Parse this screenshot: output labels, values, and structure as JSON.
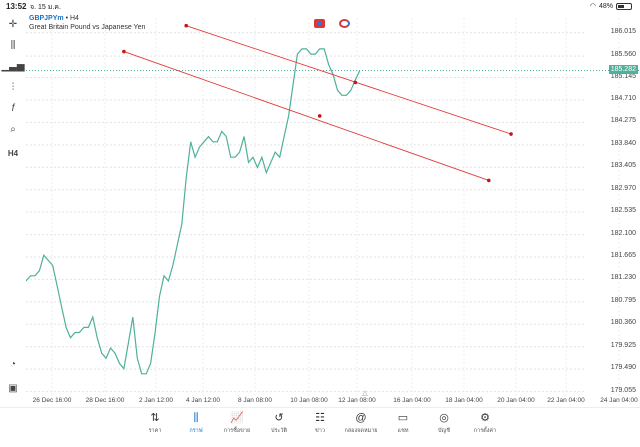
{
  "status_bar": {
    "time": "13:52",
    "date": "จ. 15 ม.ค.",
    "battery": "48%",
    "battery_level": 0.48
  },
  "chart_header": {
    "symbol": "GBPJPYm",
    "separator": "•",
    "timeframe": "H4",
    "description": "Great Britain Pound vs Japanese Yen"
  },
  "toolbar": {
    "timeframe_label": "H4"
  },
  "current_price": "185.282",
  "colors": {
    "price_line": "#4fb09b",
    "trend_line": "#e03c3c",
    "accent": "#1a73c8"
  },
  "chart_data": {
    "type": "line",
    "y_ticks": [
      "186.015",
      "185.560",
      "185.145",
      "184.710",
      "184.275",
      "183.840",
      "183.405",
      "182.970",
      "182.535",
      "182.100",
      "181.665",
      "181.230",
      "180.795",
      "180.360",
      "179.925",
      "179.490",
      "179.055"
    ],
    "x_ticks": [
      "26 Dec 16:00",
      "28 Dec 16:00",
      "2 Jan 12:00",
      "4 Jan 12:00",
      "8 Jan 08:00",
      "10 Jan 08:00",
      "12 Jan 08:00",
      "16 Jan 04:00",
      "18 Jan 04:00",
      "20 Jan 04:00",
      "22 Jan 04:00",
      "24 Jan 04:00"
    ],
    "ylim": [
      178.95,
      186.3
    ],
    "series": [
      {
        "values": [
          181.2,
          181.3,
          181.3,
          181.4,
          181.7,
          181.6,
          181.5,
          181.1,
          180.7,
          180.3,
          180.1,
          180.2,
          180.2,
          180.3,
          180.3,
          180.5,
          180.1,
          179.8,
          179.7,
          179.9,
          179.8,
          179.6,
          179.5,
          180.0,
          180.5,
          179.7,
          179.4,
          179.4,
          179.6,
          180.2,
          180.9,
          181.3,
          181.2,
          181.5,
          181.9,
          182.3,
          183.2,
          183.9,
          183.6,
          183.8,
          183.9,
          184.0,
          183.9,
          183.9,
          184.1,
          184.0,
          183.6,
          183.6,
          183.7,
          184.0,
          183.5,
          183.6,
          183.4,
          183.6,
          183.3,
          183.5,
          183.7,
          183.6,
          184.0,
          184.4,
          185.0,
          185.6,
          185.7,
          185.7,
          185.6,
          185.6,
          185.7,
          185.7,
          185.4,
          185.2,
          184.9,
          184.8,
          184.8,
          184.9,
          185.1,
          185.28
        ]
      }
    ],
    "trend_lines": [
      {
        "from": {
          "x": 36,
          "y": 186.15
        },
        "to": {
          "x": 109,
          "y": 184.05
        }
      },
      {
        "from": {
          "x": 22,
          "y": 185.65
        },
        "to": {
          "x": 104,
          "y": 183.15
        }
      }
    ],
    "trend_anchor_points": [
      {
        "x": 36,
        "y": 186.15
      },
      {
        "x": 74,
        "y": 185.05
      },
      {
        "x": 109,
        "y": 184.05
      },
      {
        "x": 22,
        "y": 185.65
      },
      {
        "x": 66,
        "y": 184.4
      },
      {
        "x": 104,
        "y": 183.15
      }
    ],
    "grid": true,
    "grid_style": "dotted"
  },
  "bottom_nav": [
    {
      "key": "quotes",
      "label": "ราคา",
      "icon": "arrows-updown-icon",
      "glyph": "⇅"
    },
    {
      "key": "chart",
      "label": "กราฟ",
      "icon": "candlestick-icon",
      "glyph": "⫼",
      "active": true
    },
    {
      "key": "trade",
      "label": "การซื้อขาย",
      "icon": "trend-chart-icon",
      "glyph": "📈"
    },
    {
      "key": "history",
      "label": "ประวัติ",
      "icon": "history-icon",
      "glyph": "↺"
    },
    {
      "key": "news",
      "label": "ข่าว",
      "icon": "news-icon",
      "glyph": "☷"
    },
    {
      "key": "mailbox",
      "label": "กล่องจดหมาย",
      "icon": "at-icon",
      "glyph": "@"
    },
    {
      "key": "chat",
      "label": "แชท",
      "icon": "chat-icon",
      "glyph": "▭"
    },
    {
      "key": "account",
      "label": "บัญชี",
      "icon": "account-icon",
      "glyph": "◎"
    },
    {
      "key": "settings",
      "label": "การตั้งค่า",
      "icon": "gear-icon",
      "glyph": "⚙"
    }
  ]
}
